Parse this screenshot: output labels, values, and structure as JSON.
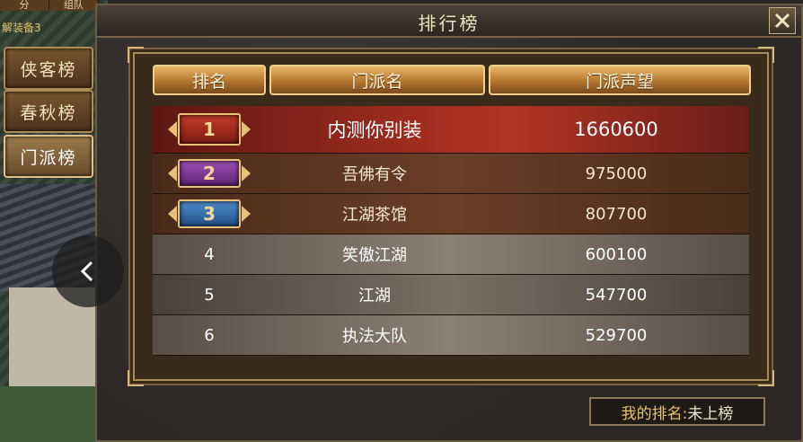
{
  "window": {
    "title": "排行榜",
    "close_label": "X"
  },
  "left_panel": {
    "top_tabs": [
      "分",
      "组队"
    ],
    "side_label": "解装备3",
    "side_tabs": [
      {
        "label": "侠客榜",
        "active": false
      },
      {
        "label": "春秋榜",
        "active": false
      },
      {
        "label": "门派榜",
        "active": true
      }
    ]
  },
  "table": {
    "headers": [
      "排名",
      "门派名",
      "门派声望"
    ],
    "rows": [
      {
        "rank": "1",
        "name": "内测你别装",
        "fame": "1660600",
        "badge": "red"
      },
      {
        "rank": "2",
        "name": "吾佛有令",
        "fame": "975000",
        "badge": "purple"
      },
      {
        "rank": "3",
        "name": "江湖茶馆",
        "fame": "807700",
        "badge": "blue"
      },
      {
        "rank": "4",
        "name": "笑傲江湖",
        "fame": "600100",
        "badge": ""
      },
      {
        "rank": "5",
        "name": "江湖",
        "fame": "547700",
        "badge": ""
      },
      {
        "rank": "6",
        "name": "执法大队",
        "fame": "529700",
        "badge": ""
      }
    ]
  },
  "my_rank": {
    "label": "我的排名:",
    "value": "未上榜"
  }
}
